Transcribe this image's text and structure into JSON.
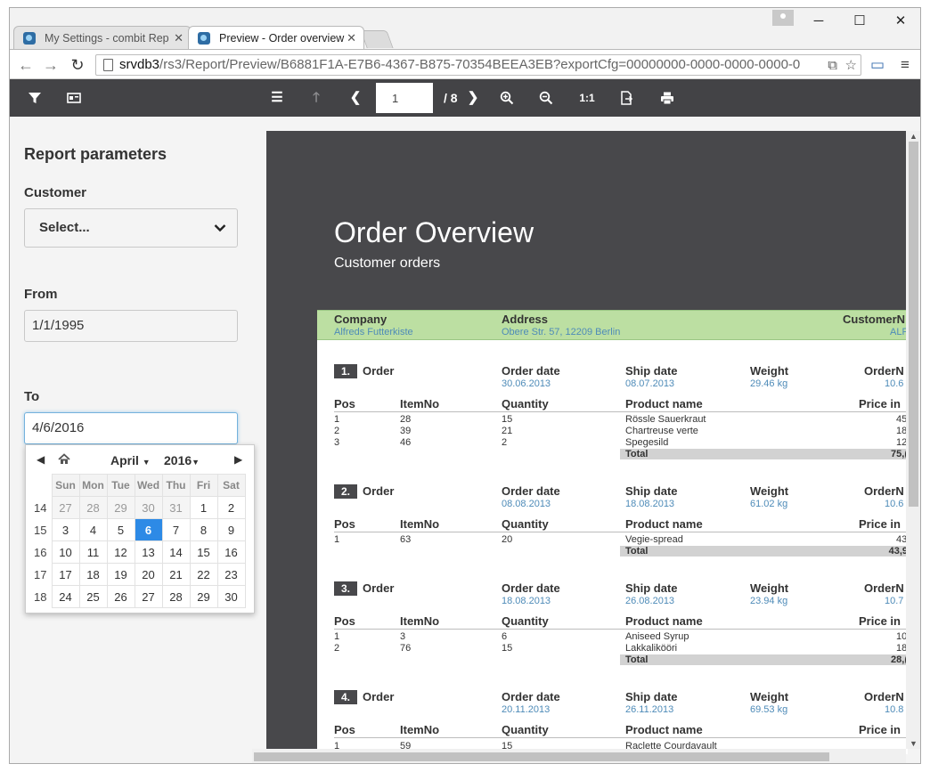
{
  "browser": {
    "tabs": [
      {
        "title": "My Settings - combit Rep"
      },
      {
        "title": "Preview - Order overview"
      }
    ],
    "url_host": "srvdb3",
    "url_path": "/rs3/Report/Preview/B6881F1A-E7B6-4367-B875-70354BEEA3EB?exportCfg=00000000-0000-0000-0000-0"
  },
  "viewer": {
    "current_page": "1",
    "total_pages": "/ 8",
    "actual_size_label": "1:1"
  },
  "params": {
    "heading": "Report parameters",
    "customer_label": "Customer",
    "customer_value": "Select...",
    "from_label": "From",
    "from_value": "1/1/1995",
    "to_label": "To",
    "to_value": "4/6/2016"
  },
  "datepicker": {
    "month": "April",
    "year": "2016",
    "days_of_week": [
      "Sun",
      "Mon",
      "Tue",
      "Wed",
      "Thu",
      "Fri",
      "Sat"
    ],
    "weeks": [
      {
        "wk": "14",
        "days": [
          "27",
          "28",
          "29",
          "30",
          "31",
          "1",
          "2"
        ]
      },
      {
        "wk": "15",
        "days": [
          "3",
          "4",
          "5",
          "6",
          "7",
          "8",
          "9"
        ]
      },
      {
        "wk": "16",
        "days": [
          "10",
          "11",
          "12",
          "13",
          "14",
          "15",
          "16"
        ]
      },
      {
        "wk": "17",
        "days": [
          "17",
          "18",
          "19",
          "20",
          "21",
          "22",
          "23"
        ]
      },
      {
        "wk": "18",
        "days": [
          "24",
          "25",
          "26",
          "27",
          "28",
          "29",
          "30"
        ]
      }
    ],
    "selected_day": "6"
  },
  "report": {
    "title": "Order Overview",
    "subtitle": "Customer orders",
    "customer_headers": {
      "company": "Company",
      "address": "Address",
      "customer": "CustomerN"
    },
    "customer": {
      "company": "Alfreds Futterkiste",
      "address": "Obere Str. 57, 12209 Berlin",
      "id": "ALF"
    },
    "order_label": "Order",
    "col_headers": {
      "order_date": "Order date",
      "ship_date": "Ship date",
      "weight": "Weight",
      "order_no": "OrderN",
      "pos": "Pos",
      "item_no": "ItemNo",
      "quantity": "Quantity",
      "product": "Product name",
      "price": "Price in"
    },
    "total_label": "Total",
    "orders": [
      {
        "num": "1.",
        "order_date": "30.06.2013",
        "ship_date": "08.07.2013",
        "weight": "29.46 kg",
        "order_no": "10.6",
        "lines": [
          {
            "pos": "1",
            "item": "28",
            "qty": "15",
            "product": "Rössle Sauerkraut",
            "price": "45,"
          },
          {
            "pos": "2",
            "item": "39",
            "qty": "21",
            "product": "Chartreuse verte",
            "price": "18,"
          },
          {
            "pos": "3",
            "item": "46",
            "qty": "2",
            "product": "Spegesild",
            "price": "12,"
          }
        ],
        "total": "75,("
      },
      {
        "num": "2.",
        "order_date": "08.08.2013",
        "ship_date": "18.08.2013",
        "weight": "61.02 kg",
        "order_no": "10.6",
        "lines": [
          {
            "pos": "1",
            "item": "63",
            "qty": "20",
            "product": "Vegie-spread",
            "price": "43,"
          }
        ],
        "total": "43,9"
      },
      {
        "num": "3.",
        "order_date": "18.08.2013",
        "ship_date": "26.08.2013",
        "weight": "23.94 kg",
        "order_no": "10.7",
        "lines": [
          {
            "pos": "1",
            "item": "3",
            "qty": "6",
            "product": "Aniseed Syrup",
            "price": "10,"
          },
          {
            "pos": "2",
            "item": "76",
            "qty": "15",
            "product": "Lakkalikööri",
            "price": "18,"
          }
        ],
        "total": "28,("
      },
      {
        "num": "4.",
        "order_date": "20.11.2013",
        "ship_date": "26.11.2013",
        "weight": "69.53 kg",
        "order_no": "10.8",
        "lines": [
          {
            "pos": "1",
            "item": "59",
            "qty": "15",
            "product": "Raclette Courdavault",
            "price": ""
          }
        ],
        "total": ""
      }
    ]
  }
}
